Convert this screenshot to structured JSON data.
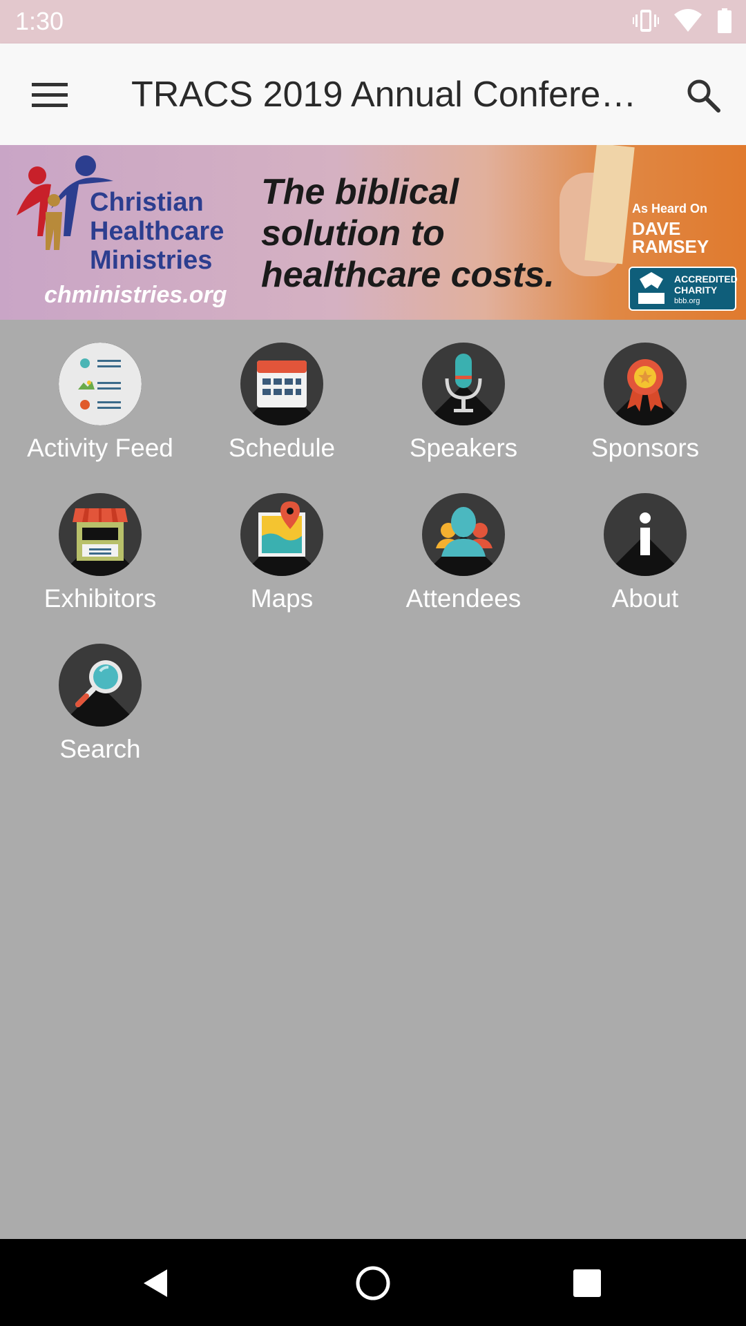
{
  "status_bar": {
    "time": "1:30",
    "icons": [
      "vibrate-icon",
      "wifi-icon",
      "battery-icon"
    ]
  },
  "app_bar": {
    "title": "TRACS 2019 Annual Conferen…",
    "menu_icon": "hamburger-menu-icon",
    "search_icon": "search-icon"
  },
  "banner": {
    "organization": [
      "Christian",
      "Healthcare",
      "Ministries"
    ],
    "url": "chministries.org",
    "tagline": [
      "The biblical",
      "solution to",
      "healthcare costs."
    ],
    "heard_on": "As Heard On",
    "show_name": [
      "DAVE",
      "RAMSEY"
    ],
    "bbb_text": [
      "ACCREDITED",
      "CHARITY"
    ],
    "bbb_url": "bbb.org"
  },
  "grid": {
    "items": [
      {
        "label": "Activity Feed",
        "icon": "activity-feed-icon"
      },
      {
        "label": "Schedule",
        "icon": "calendar-icon"
      },
      {
        "label": "Speakers",
        "icon": "microphone-icon"
      },
      {
        "label": "Sponsors",
        "icon": "ribbon-award-icon"
      },
      {
        "label": "Exhibitors",
        "icon": "booth-icon"
      },
      {
        "label": "Maps",
        "icon": "map-pin-icon"
      },
      {
        "label": "Attendees",
        "icon": "people-icon"
      },
      {
        "label": "About",
        "icon": "info-icon"
      },
      {
        "label": "Search",
        "icon": "magnifier-icon"
      }
    ]
  },
  "colors": {
    "status_bar": "#e3c8cd",
    "app_bar": "#f8f8f8",
    "background": "#ababab",
    "icon_circle": "#3a3a3a",
    "nav_bar": "#000000"
  },
  "nav_bar": {
    "icons": [
      "back-icon",
      "home-icon",
      "recents-icon"
    ]
  }
}
